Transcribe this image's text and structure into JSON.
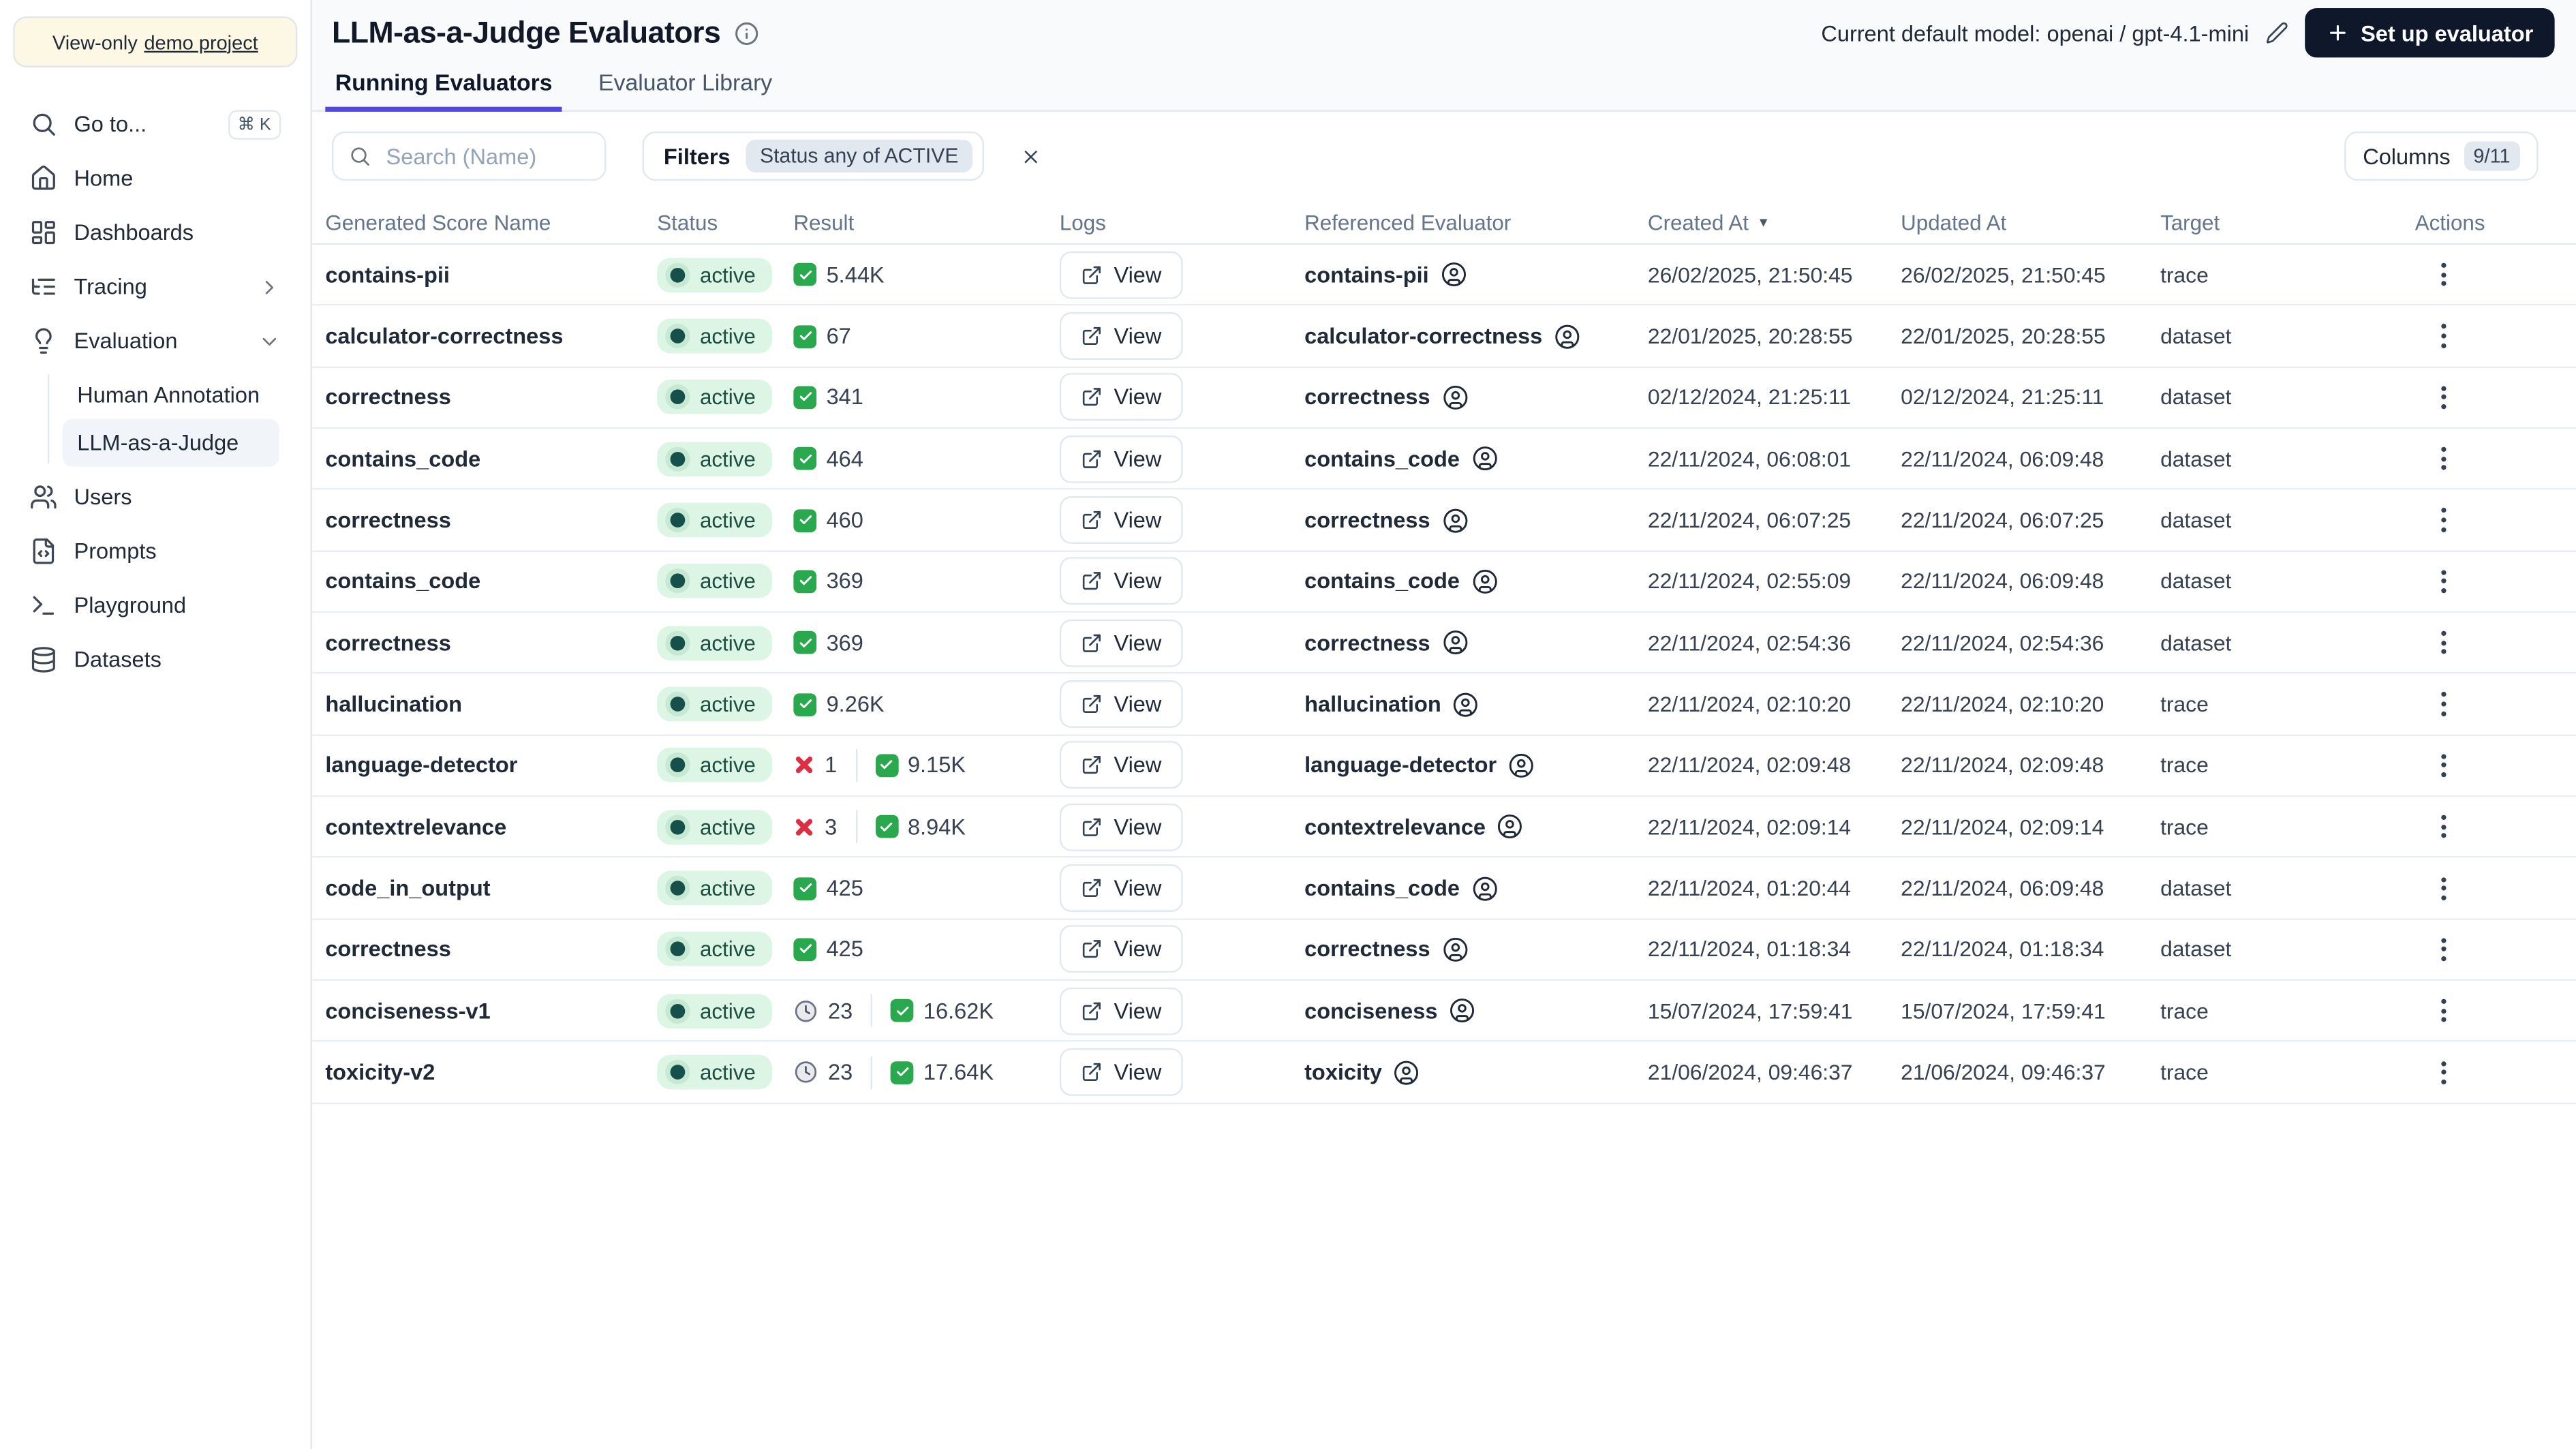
{
  "sidebar": {
    "banner": {
      "prefix": "View-only",
      "link": "demo project"
    },
    "goto": {
      "label": "Go to...",
      "shortcut": "⌘ K"
    },
    "items": [
      {
        "label": "Home"
      },
      {
        "label": "Dashboards"
      },
      {
        "label": "Tracing"
      },
      {
        "label": "Evaluation"
      }
    ],
    "sub": [
      {
        "label": "Human Annotation",
        "active": false
      },
      {
        "label": "LLM-as-a-Judge",
        "active": true
      }
    ],
    "items_bottom": [
      {
        "label": "Users"
      },
      {
        "label": "Prompts"
      },
      {
        "label": "Playground"
      },
      {
        "label": "Datasets"
      }
    ]
  },
  "header": {
    "title": "LLM-as-a-Judge Evaluators",
    "default_model_label": "Current default model:",
    "default_model_value": "openai / gpt-4.1-mini",
    "setup_button": "Set up evaluator"
  },
  "tabs": [
    {
      "label": "Running Evaluators",
      "active": true
    },
    {
      "label": "Evaluator Library",
      "active": false
    }
  ],
  "toolbar": {
    "search_placeholder": "Search (Name)",
    "filters_label": "Filters",
    "filter_chip": "Status any of ACTIVE",
    "columns_label": "Columns",
    "columns_count": "9/11"
  },
  "colors": {
    "accent": "#4f46e5",
    "status_active_bg": "#ddf5e5",
    "status_active_text": "#1b4d42",
    "success_green": "#2aa84e",
    "error_red": "#dd2e44",
    "dark_button": "#0f172a"
  },
  "table": {
    "columns": [
      "Generated Score Name",
      "Status",
      "Result",
      "Logs",
      "Referenced Evaluator",
      "Created At",
      "Updated At",
      "Target",
      "Actions"
    ],
    "sorted_column": "Created At",
    "sort_direction": "desc",
    "rows": [
      {
        "name": "contains-pii",
        "status": "active",
        "result": [
          {
            "type": "success",
            "value": "5.44K"
          }
        ],
        "logs": "View",
        "evaluator": "contains-pii",
        "created": "26/02/2025, 21:50:45",
        "updated": "26/02/2025, 21:50:45",
        "target": "trace"
      },
      {
        "name": "calculator-correctness",
        "status": "active",
        "result": [
          {
            "type": "success",
            "value": "67"
          }
        ],
        "logs": "View",
        "evaluator": "calculator-correctness",
        "created": "22/01/2025, 20:28:55",
        "updated": "22/01/2025, 20:28:55",
        "target": "dataset"
      },
      {
        "name": "correctness",
        "status": "active",
        "result": [
          {
            "type": "success",
            "value": "341"
          }
        ],
        "logs": "View",
        "evaluator": "correctness",
        "created": "02/12/2024, 21:25:11",
        "updated": "02/12/2024, 21:25:11",
        "target": "dataset"
      },
      {
        "name": "contains_code",
        "status": "active",
        "result": [
          {
            "type": "success",
            "value": "464"
          }
        ],
        "logs": "View",
        "evaluator": "contains_code",
        "created": "22/11/2024, 06:08:01",
        "updated": "22/11/2024, 06:09:48",
        "target": "dataset"
      },
      {
        "name": "correctness",
        "status": "active",
        "result": [
          {
            "type": "success",
            "value": "460"
          }
        ],
        "logs": "View",
        "evaluator": "correctness",
        "created": "22/11/2024, 06:07:25",
        "updated": "22/11/2024, 06:07:25",
        "target": "dataset"
      },
      {
        "name": "contains_code",
        "status": "active",
        "result": [
          {
            "type": "success",
            "value": "369"
          }
        ],
        "logs": "View",
        "evaluator": "contains_code",
        "created": "22/11/2024, 02:55:09",
        "updated": "22/11/2024, 06:09:48",
        "target": "dataset"
      },
      {
        "name": "correctness",
        "status": "active",
        "result": [
          {
            "type": "success",
            "value": "369"
          }
        ],
        "logs": "View",
        "evaluator": "correctness",
        "created": "22/11/2024, 02:54:36",
        "updated": "22/11/2024, 02:54:36",
        "target": "dataset"
      },
      {
        "name": "hallucination",
        "status": "active",
        "result": [
          {
            "type": "success",
            "value": "9.26K"
          }
        ],
        "logs": "View",
        "evaluator": "hallucination",
        "created": "22/11/2024, 02:10:20",
        "updated": "22/11/2024, 02:10:20",
        "target": "trace"
      },
      {
        "name": "language-detector",
        "status": "active",
        "result": [
          {
            "type": "error",
            "value": "1"
          },
          {
            "type": "success",
            "value": "9.15K"
          }
        ],
        "logs": "View",
        "evaluator": "language-detector",
        "created": "22/11/2024, 02:09:48",
        "updated": "22/11/2024, 02:09:48",
        "target": "trace"
      },
      {
        "name": "contextrelevance",
        "status": "active",
        "result": [
          {
            "type": "error",
            "value": "3"
          },
          {
            "type": "success",
            "value": "8.94K"
          }
        ],
        "logs": "View",
        "evaluator": "contextrelevance",
        "created": "22/11/2024, 02:09:14",
        "updated": "22/11/2024, 02:09:14",
        "target": "trace"
      },
      {
        "name": "code_in_output",
        "status": "active",
        "result": [
          {
            "type": "success",
            "value": "425"
          }
        ],
        "logs": "View",
        "evaluator": "contains_code",
        "created": "22/11/2024, 01:20:44",
        "updated": "22/11/2024, 06:09:48",
        "target": "dataset"
      },
      {
        "name": "correctness",
        "status": "active",
        "result": [
          {
            "type": "success",
            "value": "425"
          }
        ],
        "logs": "View",
        "evaluator": "correctness",
        "created": "22/11/2024, 01:18:34",
        "updated": "22/11/2024, 01:18:34",
        "target": "dataset"
      },
      {
        "name": "conciseness-v1",
        "status": "active",
        "result": [
          {
            "type": "pending",
            "value": "23"
          },
          {
            "type": "success",
            "value": "16.62K"
          }
        ],
        "logs": "View",
        "evaluator": "conciseness",
        "created": "15/07/2024, 17:59:41",
        "updated": "15/07/2024, 17:59:41",
        "target": "trace"
      },
      {
        "name": "toxicity-v2",
        "status": "active",
        "result": [
          {
            "type": "pending",
            "value": "23"
          },
          {
            "type": "success",
            "value": "17.64K"
          }
        ],
        "logs": "View",
        "evaluator": "toxicity",
        "created": "21/06/2024, 09:46:37",
        "updated": "21/06/2024, 09:46:37",
        "target": "trace"
      }
    ]
  }
}
